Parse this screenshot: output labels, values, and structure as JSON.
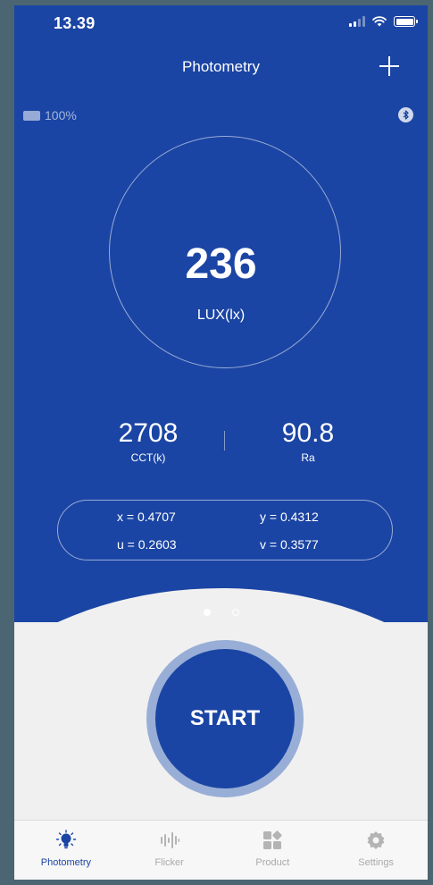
{
  "status": {
    "time": "13.39"
  },
  "nav": {
    "title": "Photometry"
  },
  "device": {
    "battery": "100%"
  },
  "measurement": {
    "lux_value": "236",
    "lux_unit": "LUX(lx)",
    "cct_value": "2708",
    "cct_label": "CCT(k)",
    "ra_value": "90.8",
    "ra_label": "Ra"
  },
  "coordinates": {
    "x": "x = 0.4707",
    "y": "y = 0.4312",
    "u": "u = 0.2603",
    "v": "v = 0.3577"
  },
  "pager": {
    "total": 2,
    "active": 0
  },
  "start": {
    "label": "START"
  },
  "tabs": [
    {
      "label": "Photometry",
      "icon": "bulb-icon",
      "active": true
    },
    {
      "label": "Flicker",
      "icon": "waveform-icon",
      "active": false
    },
    {
      "label": "Product",
      "icon": "grid-icon",
      "active": false
    },
    {
      "label": "Settings",
      "icon": "gear-icon",
      "active": false
    }
  ],
  "colors": {
    "primary": "#1b45a4",
    "ring": "#98aed6",
    "inactive": "#a9a9a9"
  }
}
